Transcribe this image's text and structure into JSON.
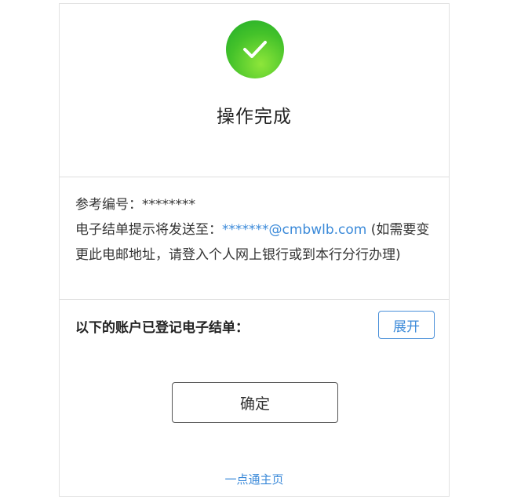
{
  "result": {
    "title": "操作完成",
    "icon": "check-icon",
    "icon_color": "#44c22a"
  },
  "info": {
    "ref_label": "参考编号：",
    "ref_value": "********",
    "notice_prefix": "电子结单提示将发送至：",
    "email": "*******@cmbwlb.com",
    "notice_suffix": " (如需要变更此电邮地址，请登入个人网上银行或到本行分行办理)"
  },
  "accounts": {
    "label": "以下的账户已登记电子结单：",
    "expand_label": "展开"
  },
  "actions": {
    "confirm_label": "确定",
    "home_link": "一点通主页"
  },
  "colors": {
    "accent": "#3b8ad9",
    "success": "#44c22a"
  }
}
